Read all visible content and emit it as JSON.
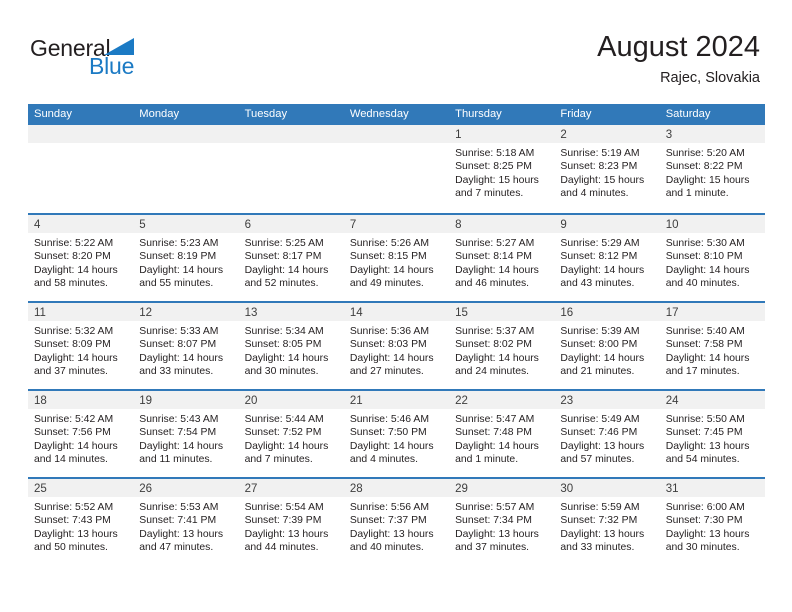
{
  "brand": {
    "logo_text_primary": "General",
    "logo_text_secondary": "Blue",
    "primary_color": "#3179b9",
    "logo_blue": "#1b7ac4"
  },
  "header": {
    "title": "August 2024",
    "subtitle": "Rajec, Slovakia"
  },
  "weekdays": [
    "Sunday",
    "Monday",
    "Tuesday",
    "Wednesday",
    "Thursday",
    "Friday",
    "Saturday"
  ],
  "weeks": [
    [
      {
        "day": "",
        "empty": true,
        "sunrise": "",
        "sunset": "",
        "daylight_1": "",
        "daylight_2": ""
      },
      {
        "day": "",
        "empty": true,
        "sunrise": "",
        "sunset": "",
        "daylight_1": "",
        "daylight_2": ""
      },
      {
        "day": "",
        "empty": true,
        "sunrise": "",
        "sunset": "",
        "daylight_1": "",
        "daylight_2": ""
      },
      {
        "day": "",
        "empty": true,
        "sunrise": "",
        "sunset": "",
        "daylight_1": "",
        "daylight_2": ""
      },
      {
        "day": "1",
        "empty": false,
        "sunrise": "Sunrise: 5:18 AM",
        "sunset": "Sunset: 8:25 PM",
        "daylight_1": "Daylight: 15 hours",
        "daylight_2": "and 7 minutes."
      },
      {
        "day": "2",
        "empty": false,
        "sunrise": "Sunrise: 5:19 AM",
        "sunset": "Sunset: 8:23 PM",
        "daylight_1": "Daylight: 15 hours",
        "daylight_2": "and 4 minutes."
      },
      {
        "day": "3",
        "empty": false,
        "sunrise": "Sunrise: 5:20 AM",
        "sunset": "Sunset: 8:22 PM",
        "daylight_1": "Daylight: 15 hours",
        "daylight_2": "and 1 minute."
      }
    ],
    [
      {
        "day": "4",
        "empty": false,
        "sunrise": "Sunrise: 5:22 AM",
        "sunset": "Sunset: 8:20 PM",
        "daylight_1": "Daylight: 14 hours",
        "daylight_2": "and 58 minutes."
      },
      {
        "day": "5",
        "empty": false,
        "sunrise": "Sunrise: 5:23 AM",
        "sunset": "Sunset: 8:19 PM",
        "daylight_1": "Daylight: 14 hours",
        "daylight_2": "and 55 minutes."
      },
      {
        "day": "6",
        "empty": false,
        "sunrise": "Sunrise: 5:25 AM",
        "sunset": "Sunset: 8:17 PM",
        "daylight_1": "Daylight: 14 hours",
        "daylight_2": "and 52 minutes."
      },
      {
        "day": "7",
        "empty": false,
        "sunrise": "Sunrise: 5:26 AM",
        "sunset": "Sunset: 8:15 PM",
        "daylight_1": "Daylight: 14 hours",
        "daylight_2": "and 49 minutes."
      },
      {
        "day": "8",
        "empty": false,
        "sunrise": "Sunrise: 5:27 AM",
        "sunset": "Sunset: 8:14 PM",
        "daylight_1": "Daylight: 14 hours",
        "daylight_2": "and 46 minutes."
      },
      {
        "day": "9",
        "empty": false,
        "sunrise": "Sunrise: 5:29 AM",
        "sunset": "Sunset: 8:12 PM",
        "daylight_1": "Daylight: 14 hours",
        "daylight_2": "and 43 minutes."
      },
      {
        "day": "10",
        "empty": false,
        "sunrise": "Sunrise: 5:30 AM",
        "sunset": "Sunset: 8:10 PM",
        "daylight_1": "Daylight: 14 hours",
        "daylight_2": "and 40 minutes."
      }
    ],
    [
      {
        "day": "11",
        "empty": false,
        "sunrise": "Sunrise: 5:32 AM",
        "sunset": "Sunset: 8:09 PM",
        "daylight_1": "Daylight: 14 hours",
        "daylight_2": "and 37 minutes."
      },
      {
        "day": "12",
        "empty": false,
        "sunrise": "Sunrise: 5:33 AM",
        "sunset": "Sunset: 8:07 PM",
        "daylight_1": "Daylight: 14 hours",
        "daylight_2": "and 33 minutes."
      },
      {
        "day": "13",
        "empty": false,
        "sunrise": "Sunrise: 5:34 AM",
        "sunset": "Sunset: 8:05 PM",
        "daylight_1": "Daylight: 14 hours",
        "daylight_2": "and 30 minutes."
      },
      {
        "day": "14",
        "empty": false,
        "sunrise": "Sunrise: 5:36 AM",
        "sunset": "Sunset: 8:03 PM",
        "daylight_1": "Daylight: 14 hours",
        "daylight_2": "and 27 minutes."
      },
      {
        "day": "15",
        "empty": false,
        "sunrise": "Sunrise: 5:37 AM",
        "sunset": "Sunset: 8:02 PM",
        "daylight_1": "Daylight: 14 hours",
        "daylight_2": "and 24 minutes."
      },
      {
        "day": "16",
        "empty": false,
        "sunrise": "Sunrise: 5:39 AM",
        "sunset": "Sunset: 8:00 PM",
        "daylight_1": "Daylight: 14 hours",
        "daylight_2": "and 21 minutes."
      },
      {
        "day": "17",
        "empty": false,
        "sunrise": "Sunrise: 5:40 AM",
        "sunset": "Sunset: 7:58 PM",
        "daylight_1": "Daylight: 14 hours",
        "daylight_2": "and 17 minutes."
      }
    ],
    [
      {
        "day": "18",
        "empty": false,
        "sunrise": "Sunrise: 5:42 AM",
        "sunset": "Sunset: 7:56 PM",
        "daylight_1": "Daylight: 14 hours",
        "daylight_2": "and 14 minutes."
      },
      {
        "day": "19",
        "empty": false,
        "sunrise": "Sunrise: 5:43 AM",
        "sunset": "Sunset: 7:54 PM",
        "daylight_1": "Daylight: 14 hours",
        "daylight_2": "and 11 minutes."
      },
      {
        "day": "20",
        "empty": false,
        "sunrise": "Sunrise: 5:44 AM",
        "sunset": "Sunset: 7:52 PM",
        "daylight_1": "Daylight: 14 hours",
        "daylight_2": "and 7 minutes."
      },
      {
        "day": "21",
        "empty": false,
        "sunrise": "Sunrise: 5:46 AM",
        "sunset": "Sunset: 7:50 PM",
        "daylight_1": "Daylight: 14 hours",
        "daylight_2": "and 4 minutes."
      },
      {
        "day": "22",
        "empty": false,
        "sunrise": "Sunrise: 5:47 AM",
        "sunset": "Sunset: 7:48 PM",
        "daylight_1": "Daylight: 14 hours",
        "daylight_2": "and 1 minute."
      },
      {
        "day": "23",
        "empty": false,
        "sunrise": "Sunrise: 5:49 AM",
        "sunset": "Sunset: 7:46 PM",
        "daylight_1": "Daylight: 13 hours",
        "daylight_2": "and 57 minutes."
      },
      {
        "day": "24",
        "empty": false,
        "sunrise": "Sunrise: 5:50 AM",
        "sunset": "Sunset: 7:45 PM",
        "daylight_1": "Daylight: 13 hours",
        "daylight_2": "and 54 minutes."
      }
    ],
    [
      {
        "day": "25",
        "empty": false,
        "sunrise": "Sunrise: 5:52 AM",
        "sunset": "Sunset: 7:43 PM",
        "daylight_1": "Daylight: 13 hours",
        "daylight_2": "and 50 minutes."
      },
      {
        "day": "26",
        "empty": false,
        "sunrise": "Sunrise: 5:53 AM",
        "sunset": "Sunset: 7:41 PM",
        "daylight_1": "Daylight: 13 hours",
        "daylight_2": "and 47 minutes."
      },
      {
        "day": "27",
        "empty": false,
        "sunrise": "Sunrise: 5:54 AM",
        "sunset": "Sunset: 7:39 PM",
        "daylight_1": "Daylight: 13 hours",
        "daylight_2": "and 44 minutes."
      },
      {
        "day": "28",
        "empty": false,
        "sunrise": "Sunrise: 5:56 AM",
        "sunset": "Sunset: 7:37 PM",
        "daylight_1": "Daylight: 13 hours",
        "daylight_2": "and 40 minutes."
      },
      {
        "day": "29",
        "empty": false,
        "sunrise": "Sunrise: 5:57 AM",
        "sunset": "Sunset: 7:34 PM",
        "daylight_1": "Daylight: 13 hours",
        "daylight_2": "and 37 minutes."
      },
      {
        "day": "30",
        "empty": false,
        "sunrise": "Sunrise: 5:59 AM",
        "sunset": "Sunset: 7:32 PM",
        "daylight_1": "Daylight: 13 hours",
        "daylight_2": "and 33 minutes."
      },
      {
        "day": "31",
        "empty": false,
        "sunrise": "Sunrise: 6:00 AM",
        "sunset": "Sunset: 7:30 PM",
        "daylight_1": "Daylight: 13 hours",
        "daylight_2": "and 30 minutes."
      }
    ]
  ]
}
